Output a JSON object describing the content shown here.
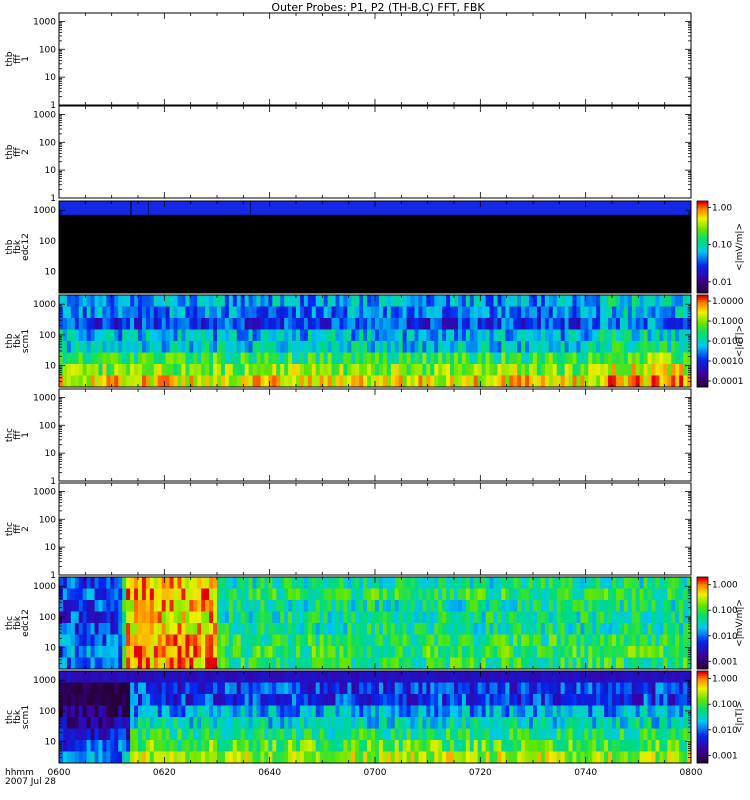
{
  "title": "Outer Probes: P1, P2 (TH-B,C) FFT, FBK",
  "chart_data": {
    "type": "heatmap",
    "title": "Outer Probes: P1, P2 (TH-B,C) FFT, FBK",
    "x_ticks": [
      "0600",
      "0620",
      "0640",
      "0700",
      "0720",
      "0740",
      "0800"
    ],
    "x_label_line1": "hhmm",
    "x_label_line2": "2007 Jul 28",
    "panels": [
      {
        "id": "thb-fff1",
        "ylabel": [
          "thb",
          "fff",
          "1"
        ],
        "yticks": [
          "1000",
          "100",
          "10",
          "1"
        ],
        "ylog": [
          1,
          2000
        ],
        "spectrogram": false
      },
      {
        "id": "thb-fff2",
        "ylabel": [
          "thb",
          "fff",
          "2"
        ],
        "yticks": [
          "1000",
          "100",
          "10",
          "1"
        ],
        "ylog": [
          1,
          2000
        ],
        "spectrogram": false
      },
      {
        "id": "thb-fbk-edc12",
        "ylabel": [
          "thb",
          "fbk",
          "edc12"
        ],
        "yticks": [
          "1000",
          "100",
          "10"
        ],
        "ylog": [
          2,
          2000
        ],
        "spectrogram": true,
        "colorbar": {
          "label": "<|mV/m|>",
          "ticks": [
            "1.00",
            "0.10",
            "0.01"
          ],
          "cmin": 0.005,
          "cmax": 1.5
        }
      },
      {
        "id": "thb-fbk-scm1",
        "ylabel": [
          "thb",
          "fbk",
          "scm1"
        ],
        "yticks": [
          "1000",
          "100",
          "10"
        ],
        "ylog": [
          2,
          2000
        ],
        "spectrogram": true,
        "colorbar": {
          "label": "<|nT|>",
          "ticks": [
            "1.0000",
            "0.1000",
            "0.0100",
            "0.0010",
            "0.0001"
          ],
          "cmin": 5e-05,
          "cmax": 2
        }
      },
      {
        "id": "thc-fff1",
        "ylabel": [
          "thc",
          "fff",
          "1"
        ],
        "yticks": [
          "1000",
          "100",
          "10",
          "1"
        ],
        "ylog": [
          1,
          2000
        ],
        "spectrogram": false
      },
      {
        "id": "thc-fff2",
        "ylabel": [
          "thc",
          "fff",
          "2"
        ],
        "yticks": [
          "1000",
          "100",
          "10",
          "1"
        ],
        "ylog": [
          1,
          2000
        ],
        "spectrogram": false
      },
      {
        "id": "thc-fbk-edc12",
        "ylabel": [
          "thc",
          "fbk",
          "edc12"
        ],
        "yticks": [
          "1000",
          "100",
          "10"
        ],
        "ylog": [
          2,
          2000
        ],
        "spectrogram": true,
        "colorbar": {
          "label": "<|mV/m|>",
          "ticks": [
            "1.000",
            "0.100",
            "0.010",
            "0.001"
          ],
          "cmin": 0.0005,
          "cmax": 2
        }
      },
      {
        "id": "thc-fbk-scm1",
        "ylabel": [
          "thc",
          "fbk",
          "scm1"
        ],
        "yticks": [
          "1000",
          "100",
          "10"
        ],
        "ylog": [
          2,
          2000
        ],
        "spectrogram": true,
        "colorbar": {
          "label": "<|nT|>",
          "ticks": [
            "1.000",
            "0.100",
            "0.010",
            "0.001"
          ],
          "cmin": 0.0005,
          "cmax": 2
        }
      }
    ]
  },
  "colors": {
    "panel_border": "#000000",
    "spectrogram_background": "#000000"
  }
}
